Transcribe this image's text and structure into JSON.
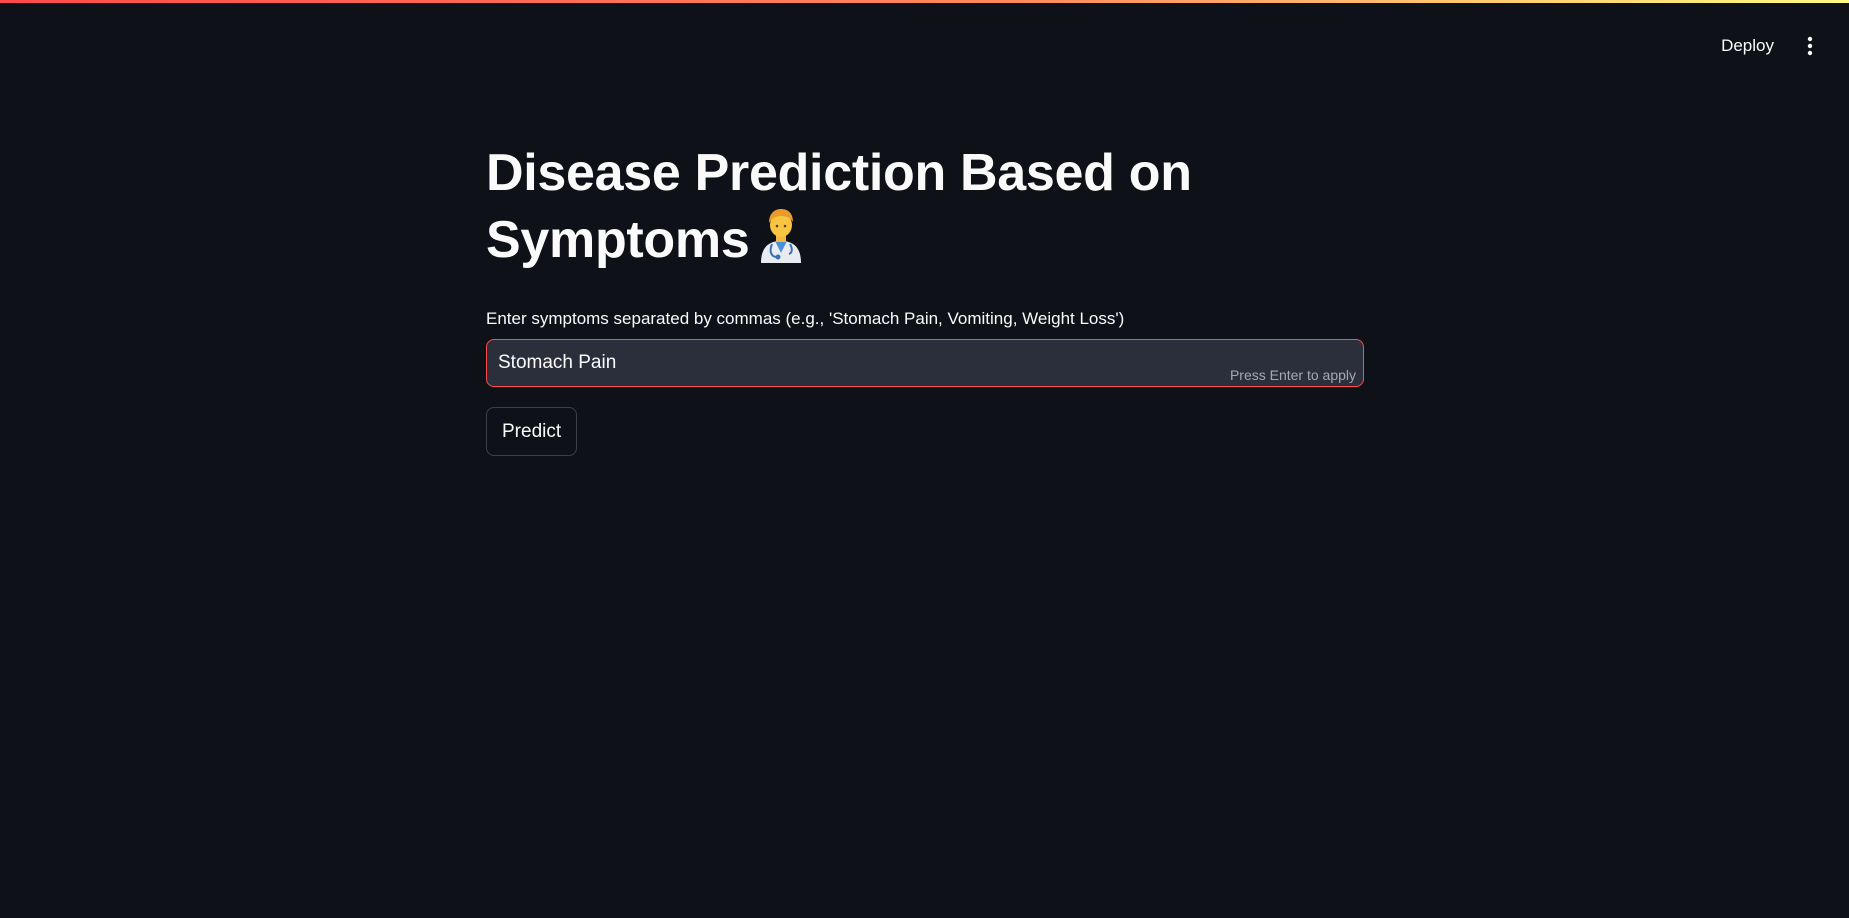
{
  "header": {
    "deploy_label": "Deploy",
    "menu_icon": "more-vertical-icon"
  },
  "main": {
    "title": "Disease Prediction Based on Symptoms",
    "title_emoji": "health-worker-emoji",
    "input_label": "Enter symptoms separated by commas (e.g., 'Stomach Pain, Vomiting, Weight Loss')",
    "input_value": "Stomach Pain",
    "input_hint": "Press Enter to apply",
    "predict_label": "Predict"
  },
  "colors": {
    "background": "#0e1117",
    "accent": "#ff4b4b",
    "input_bg": "#2b2f3b",
    "text": "#fafafa"
  }
}
